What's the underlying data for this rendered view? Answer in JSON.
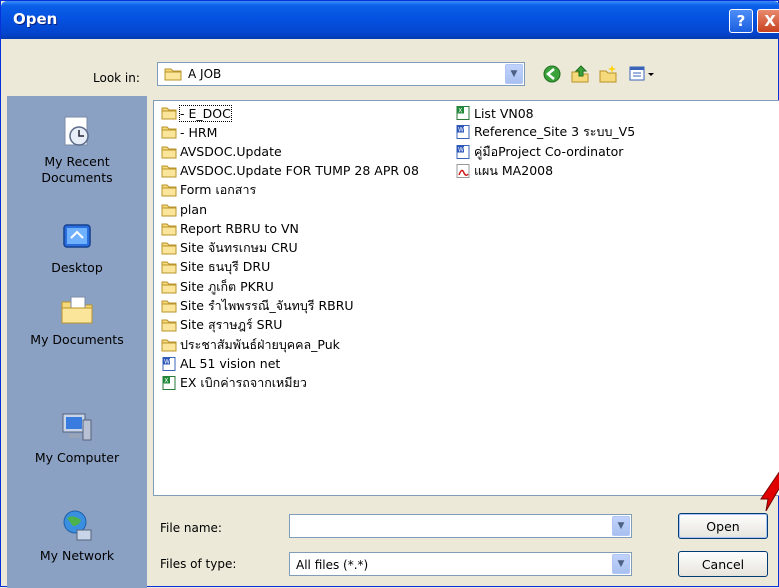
{
  "window": {
    "title": "Open"
  },
  "title_buttons": {
    "help": "?",
    "close": "X"
  },
  "toolbar": {
    "look_in_label": "Look in:",
    "look_in_value": "A JOB",
    "icons": [
      "back-icon",
      "up-folder-icon",
      "new-folder-icon",
      "view-menu-icon"
    ]
  },
  "places": [
    {
      "label": "My Recent Documents",
      "icon": "recent-documents-icon"
    },
    {
      "label": "Desktop",
      "icon": "desktop-icon"
    },
    {
      "label": "My Documents",
      "icon": "my-documents-icon"
    },
    {
      "label": "My Computer",
      "icon": "my-computer-icon"
    },
    {
      "label": "My Network",
      "icon": "my-network-icon"
    }
  ],
  "files_col1": [
    {
      "name": "- E_DOC",
      "type": "folder"
    },
    {
      "name": "- HRM",
      "type": "folder"
    },
    {
      "name": "AVSDOC.Update",
      "type": "folder"
    },
    {
      "name": "AVSDOC.Update FOR TUMP 28 APR 08",
      "type": "folder"
    },
    {
      "name": "Form เอกสาร",
      "type": "folder"
    },
    {
      "name": "plan",
      "type": "folder"
    },
    {
      "name": "Report RBRU to VN",
      "type": "folder"
    },
    {
      "name": "Site จันทรเกษม CRU",
      "type": "folder"
    },
    {
      "name": "Site ธนบุรี DRU",
      "type": "folder"
    },
    {
      "name": "Site ภูเก็ต PKRU",
      "type": "folder"
    },
    {
      "name": "Site รำไพพรรณี_จันทบุรี RBRU",
      "type": "folder"
    },
    {
      "name": "Site สุราษฎร์ SRU",
      "type": "folder"
    },
    {
      "name": "ประชาสัมพันธ์ฝ่ายบุคคล_Puk",
      "type": "folder"
    },
    {
      "name": "AL 51 vision net",
      "type": "word"
    },
    {
      "name": "EX เบิกค่ารถจากเหมียว",
      "type": "excel"
    }
  ],
  "files_col2": [
    {
      "name": "List VN08",
      "type": "excel"
    },
    {
      "name": "Reference_Site 3 ระบบ_V5",
      "type": "word"
    },
    {
      "name": "คู่มือProject Co-ordinator",
      "type": "word"
    },
    {
      "name": "แผน MA2008",
      "type": "pdf"
    }
  ],
  "footer": {
    "file_name_label": "File name:",
    "file_name_value": "",
    "files_of_type_label": "Files of type:",
    "files_of_type_value": "All files (*.*)",
    "open_label": "Open",
    "cancel_label": "Cancel"
  },
  "colors": {
    "title_bar": "#0550e0",
    "places_bar": "#8ba1c4",
    "dialog_bg": "#ece9d8",
    "annotation_arrow": "#e00000"
  }
}
